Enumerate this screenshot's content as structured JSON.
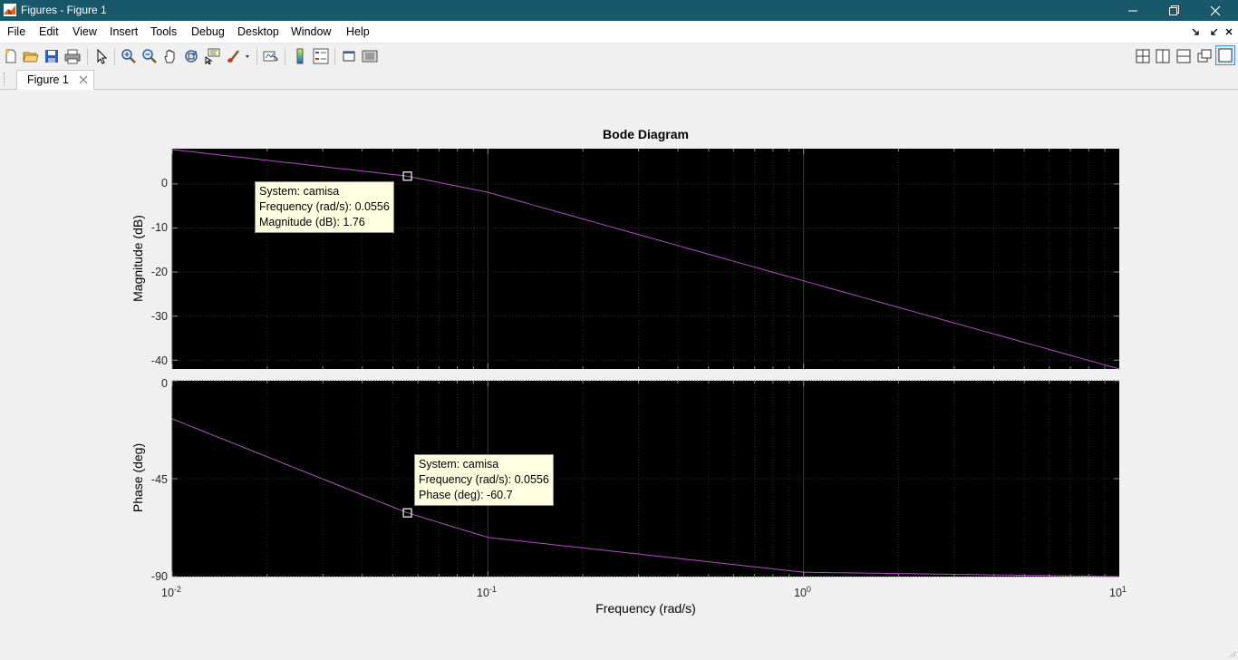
{
  "window": {
    "title": "Figures - Figure 1",
    "controls": [
      "minimize-icon",
      "restore-icon",
      "close-icon"
    ]
  },
  "menu": [
    "File",
    "Edit",
    "View",
    "Insert",
    "Tools",
    "Debug",
    "Desktop",
    "Window",
    "Help"
  ],
  "toolbar": {
    "icons": [
      "new-figure-icon",
      "open-icon",
      "save-icon",
      "print-icon",
      "edit-plot-icon",
      "zoom-in-icon",
      "zoom-out-icon",
      "pan-icon",
      "rotate-3d-icon",
      "data-cursor-icon",
      "brush-icon",
      "link-plot-icon",
      "colorbar-icon",
      "legend-icon",
      "hide-plot-tools-icon",
      "show-plot-tools-icon"
    ],
    "layout_icons": [
      "tile-2x2-icon",
      "tile-columns-icon",
      "tile-rows-icon",
      "float-icon",
      "maximize-icon"
    ]
  },
  "tab": {
    "label": "Figure 1"
  },
  "chart_data": {
    "type": "line",
    "title": "Bode Diagram",
    "xlabel": "Frequency  (rad/s)",
    "x_scale": "log",
    "xlim": [
      0.01,
      10
    ],
    "x_ticks": [
      {
        "base": "10",
        "exp": "-2"
      },
      {
        "base": "10",
        "exp": "-1"
      },
      {
        "base": "10",
        "exp": "0"
      },
      {
        "base": "10",
        "exp": "1"
      }
    ],
    "background": "#000000",
    "line_color": "#b04fc0",
    "grid": true,
    "series": [
      {
        "name": "camisa",
        "panel": "magnitude",
        "x": [
          0.01,
          0.0556,
          0.1,
          1,
          10
        ],
        "y": [
          7.8,
          1.76,
          -1.9,
          -22,
          -42
        ]
      },
      {
        "name": "camisa",
        "panel": "phase",
        "x": [
          0.01,
          0.0556,
          0.1,
          1,
          10
        ],
        "y": [
          -17.5,
          -60.7,
          -72,
          -88,
          -90
        ]
      }
    ],
    "panels": [
      {
        "id": "magnitude",
        "ylabel": "Magnitude (dB)",
        "ylim": [
          -42,
          8
        ],
        "yticks": [
          "0",
          "-10",
          "-20",
          "-30",
          "-40"
        ],
        "datatip": [
          "System: camisa",
          "Frequency (rad/s): 0.0556",
          "Magnitude (dB): 1.76"
        ]
      },
      {
        "id": "phase",
        "ylabel": "Phase (deg)",
        "ylim": [
          -90,
          0
        ],
        "yticks": [
          "0",
          "-45",
          "-90"
        ],
        "datatip": [
          "System: camisa",
          "Frequency (rad/s): 0.0556",
          "Phase (deg): -60.7"
        ]
      }
    ]
  }
}
